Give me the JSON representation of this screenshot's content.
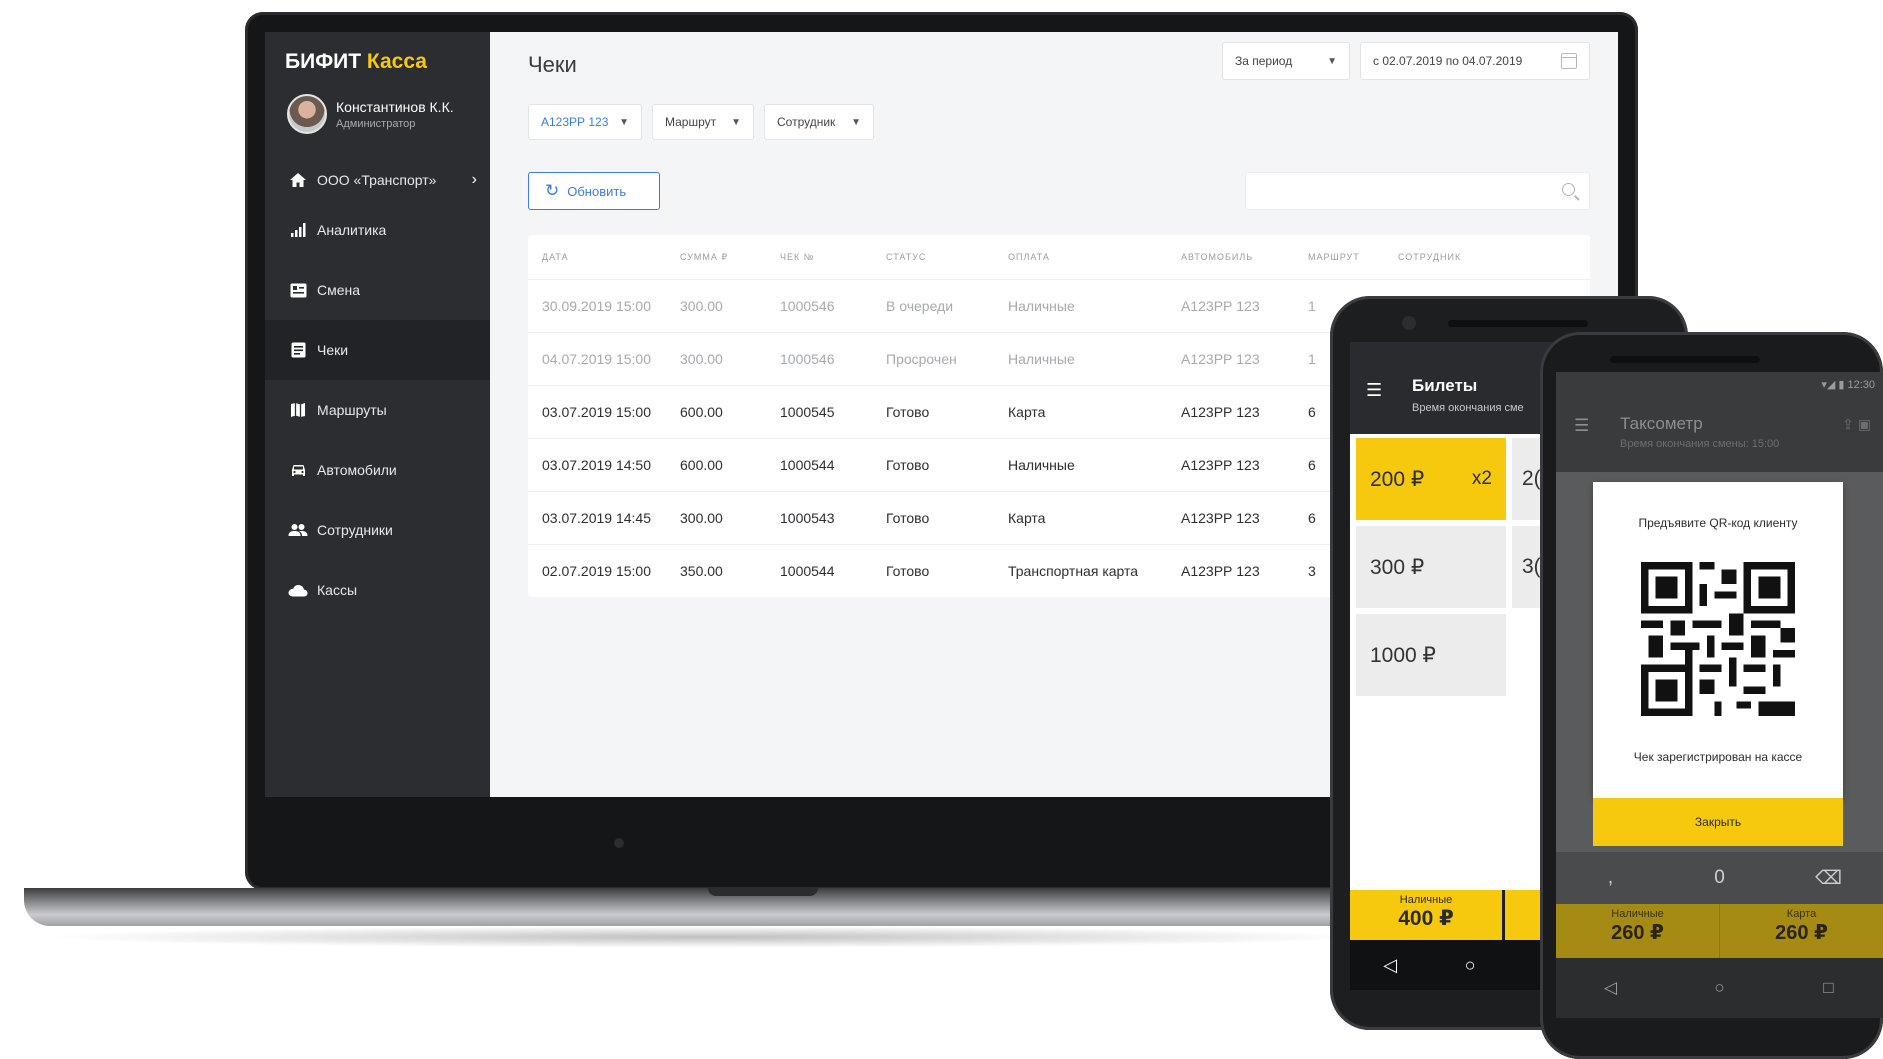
{
  "laptop": {
    "sidebar": {
      "brand_main": "БИФИТ",
      "brand_accent": "Касса",
      "user_name": "Константинов К.К.",
      "user_role": "Администратор",
      "org": "ООО «Транспорт»",
      "items": [
        {
          "label": "Аналитика",
          "icon": "chart-icon"
        },
        {
          "label": "Смена",
          "icon": "shift-icon"
        },
        {
          "label": "Чеки",
          "icon": "receipt-icon",
          "active": true
        },
        {
          "label": "Маршруты",
          "icon": "map-icon"
        },
        {
          "label": "Автомобили",
          "icon": "car-icon"
        },
        {
          "label": "Сотрудники",
          "icon": "people-icon"
        },
        {
          "label": "Кассы",
          "icon": "cloud-icon"
        }
      ]
    },
    "main": {
      "title": "Чеки",
      "period_select": "За период",
      "date_range": "с 02.07.2019 по 04.07.2019",
      "filters": {
        "car": "А123РР 123",
        "route": "Маршрут",
        "employee": "Сотрудник"
      },
      "refresh_label": "Обновить",
      "search_placeholder": "",
      "table": {
        "columns": [
          "ДАТА",
          "СУММА ₽",
          "ЧЕК №",
          "СТАТУС",
          "ОПЛАТА",
          "АВТОМОБИЛЬ",
          "МАРШРУТ",
          "СОТРУДНИК"
        ],
        "rows": [
          [
            "30.09.2019 15:00",
            "300.00",
            "1000546",
            "В очереди",
            "Наличные",
            "А123РР 123",
            "1",
            ""
          ],
          [
            "04.07.2019 15:00",
            "300.00",
            "1000546",
            "Просрочен",
            "Наличные",
            "А123РР 123",
            "1",
            ""
          ],
          [
            "03.07.2019 15:00",
            "600.00",
            "1000545",
            "Готово",
            "Карта",
            "А123РР 123",
            "6",
            ""
          ],
          [
            "03.07.2019 14:50",
            "600.00",
            "1000544",
            "Готово",
            "Наличные",
            "А123РР 123",
            "6",
            ""
          ],
          [
            "03.07.2019 14:45",
            "300.00",
            "1000543",
            "Готово",
            "Карта",
            "А123РР 123",
            "6",
            ""
          ],
          [
            "02.07.2019 15:00",
            "350.00",
            "1000544",
            "Готово",
            "Транспортная карта",
            "А123РР 123",
            "3",
            ""
          ]
        ],
        "muted_rows": [
          0,
          1
        ]
      }
    }
  },
  "phone1": {
    "title": "Билеты",
    "subtitle": "Время окончания сме",
    "tiles": [
      {
        "label": "200 ₽",
        "qty": "x2",
        "selected": true
      },
      {
        "label": "300 ₽"
      },
      {
        "label": "1000 ₽"
      }
    ],
    "tiles_right_partial": [
      "2(",
      "3("
    ],
    "pay_label": "Наличные",
    "pay_amount": "400 ₽"
  },
  "phone2": {
    "status_time": "12:30",
    "title": "Таксометр",
    "subtitle": "Время окончания смены: 15:00",
    "modal_title": "Предъявите QR-код клиенту",
    "modal_message": "Чек зарегистрирован на кассе",
    "modal_button": "Закрыть",
    "keypad": [
      ",",
      "0",
      "⌫"
    ],
    "pay": [
      {
        "label": "Наличные",
        "amount": "260 ₽"
      },
      {
        "label": "Карта",
        "amount": "260 ₽"
      }
    ]
  },
  "colors": {
    "accent_yellow": "#f6c90e",
    "link_blue": "#3b7ddd",
    "sidebar_bg": "#2b2d31"
  }
}
